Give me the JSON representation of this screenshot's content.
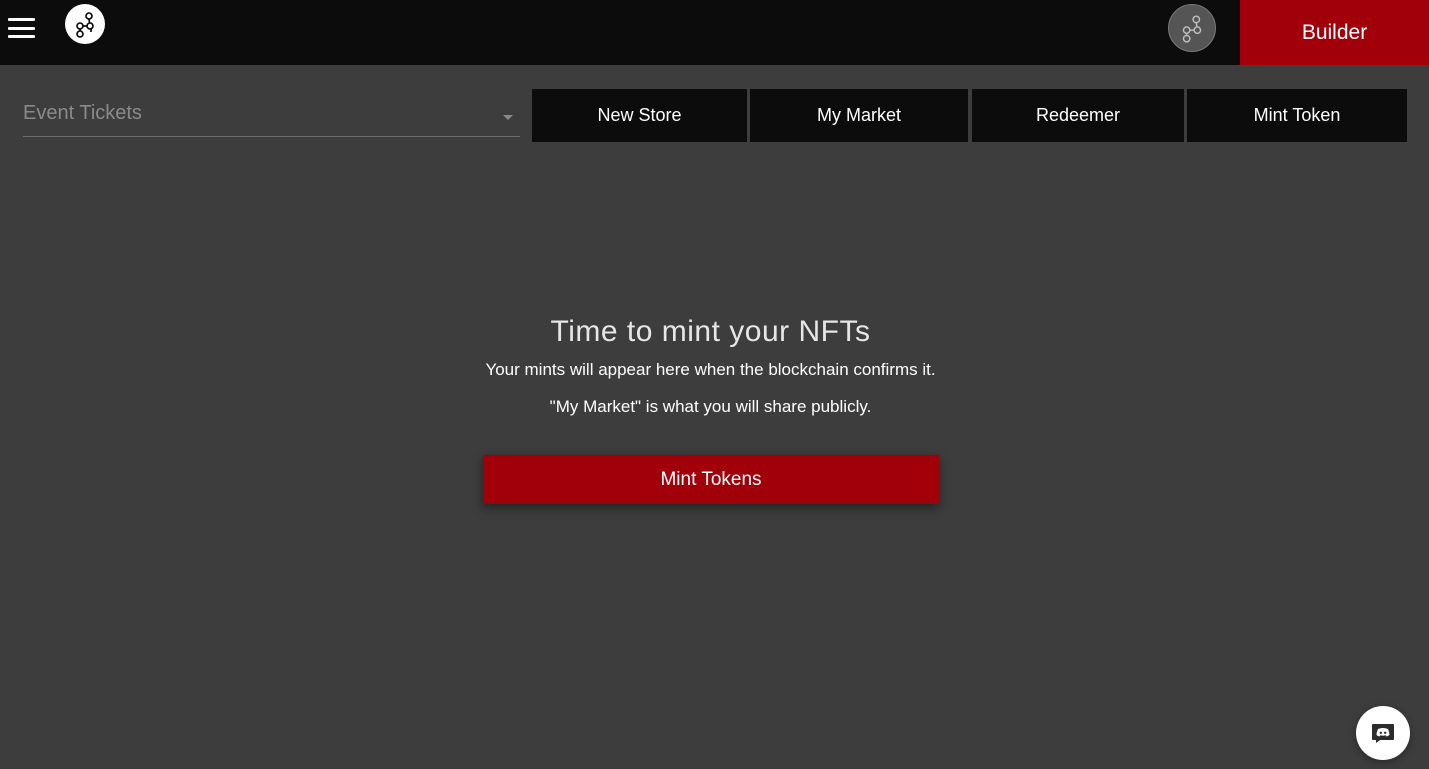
{
  "header": {
    "menu_icon": "hamburger-menu-icon",
    "logo_icon": "network-nodes-logo-icon",
    "avatar_icon": "network-nodes-avatar-icon",
    "builder_label": "Builder"
  },
  "toolbar": {
    "store_select": {
      "value": "Event Tickets",
      "icon": "caret-down-icon"
    },
    "tabs": [
      {
        "label": "New Store"
      },
      {
        "label": "My Market"
      },
      {
        "label": "Redeemer"
      },
      {
        "label": "Mint Token"
      }
    ]
  },
  "empty_state": {
    "title": "Time to mint your NFTs",
    "line1": "Your mints will appear here when the blockchain confirms it.",
    "line2": "\"My Market\" is what you will share publicly.",
    "button_label": "Mint Tokens"
  },
  "chat_widget": {
    "icon": "discord-icon"
  },
  "colors": {
    "background": "#3d3d3d",
    "topbar": "#0c0c0c",
    "accent_red": "#a1000a",
    "tab_background": "#0c0c0c",
    "muted_text": "#8a8a8a"
  }
}
